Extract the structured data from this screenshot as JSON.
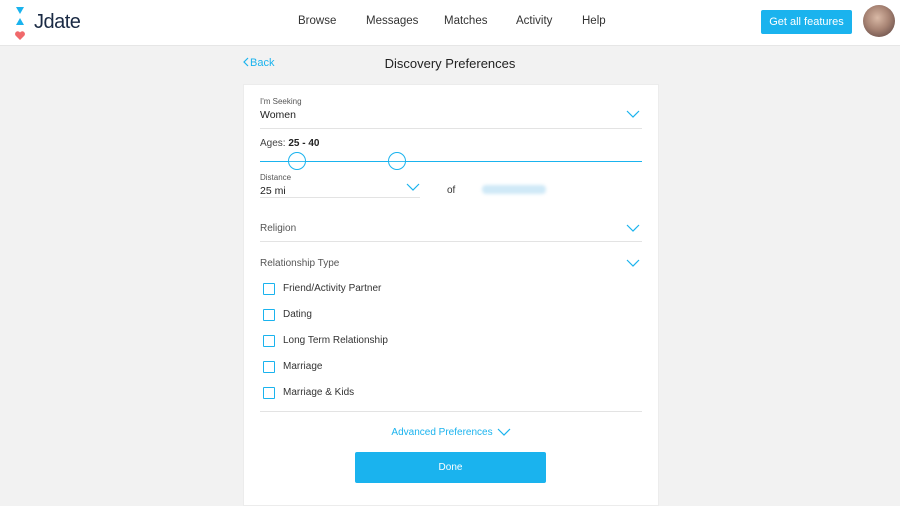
{
  "app": {
    "logo_text": "Jdate",
    "brand_color": "#1ab3ee",
    "heart_color": "#f0696b"
  },
  "nav": {
    "items": [
      "Browse",
      "Messages",
      "Matches",
      "Activity",
      "Help"
    ],
    "cta_label": "Get all features"
  },
  "header": {
    "back_label": "Back",
    "title": "Discovery Preferences"
  },
  "form": {
    "seeking": {
      "label": "I'm Seeking",
      "value": "Women"
    },
    "ages": {
      "label": "Ages:",
      "range_text": "25 - 40",
      "min": 25,
      "max": 40
    },
    "distance": {
      "label": "Distance",
      "value": "25 mi",
      "of_text": "of"
    },
    "religion": {
      "label": "Religion"
    },
    "relationship_type": {
      "label": "Relationship Type",
      "options": [
        "Friend/Activity Partner",
        "Dating",
        "Long Term Relationship",
        "Marriage",
        "Marriage & Kids"
      ]
    },
    "advanced_label": "Advanced Preferences",
    "done_label": "Done"
  }
}
